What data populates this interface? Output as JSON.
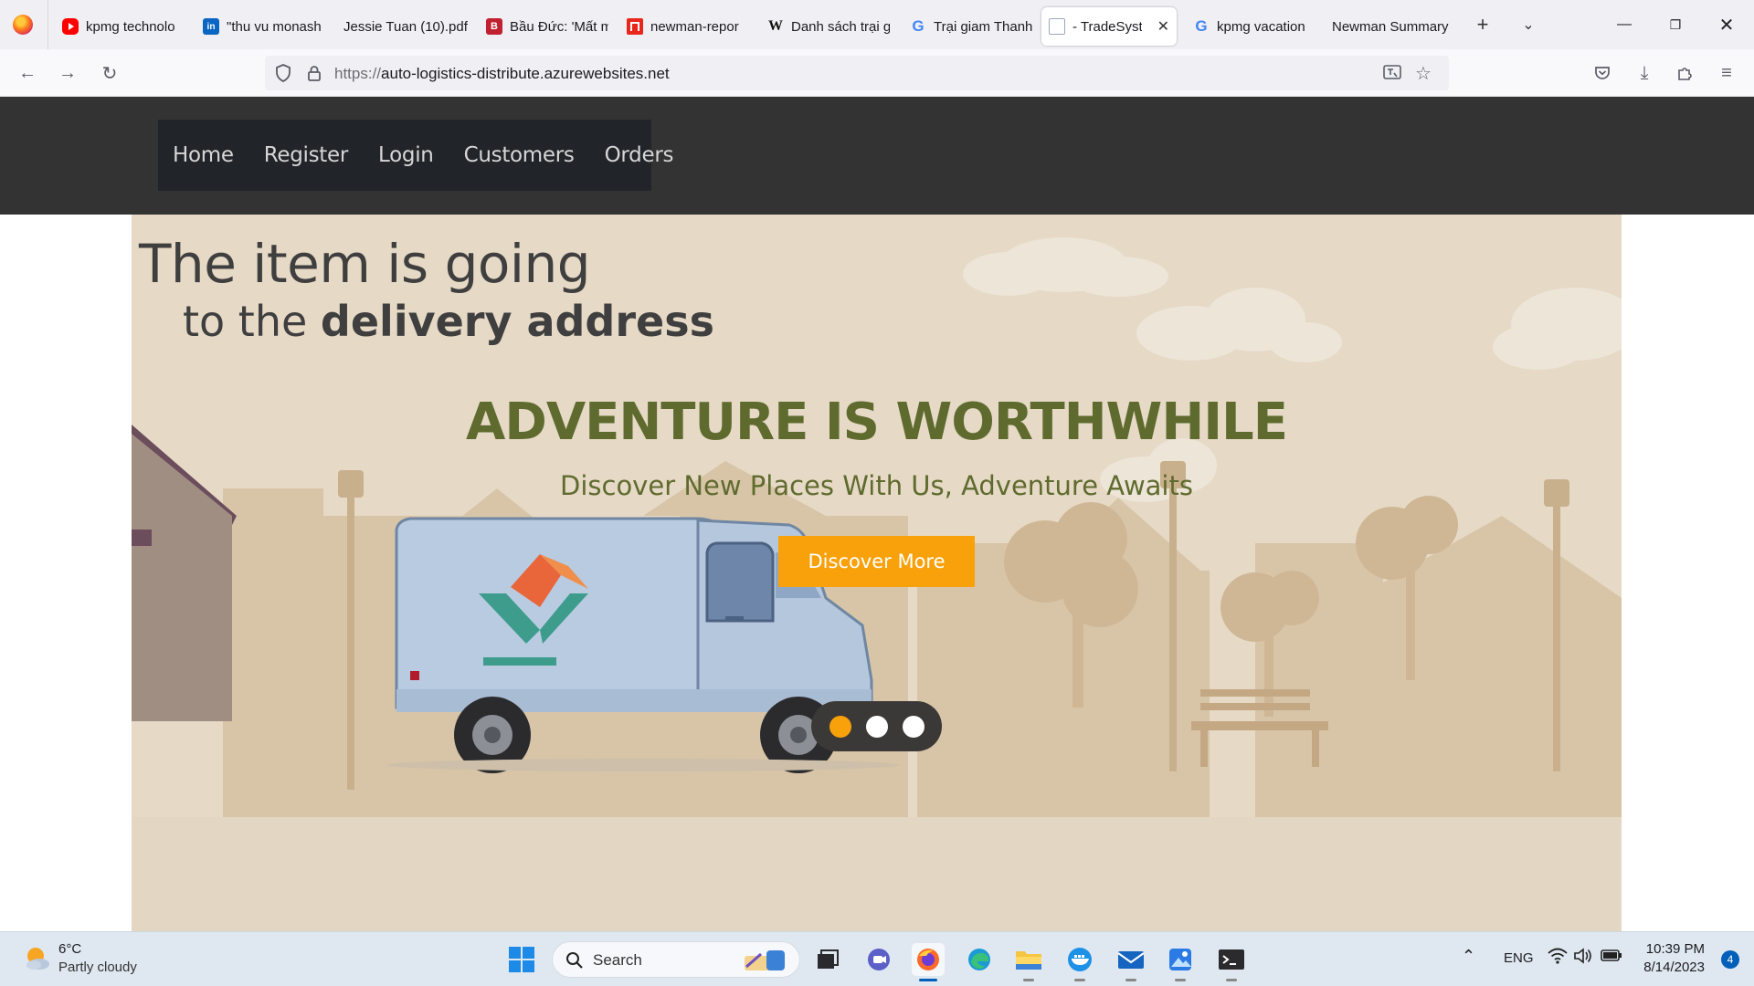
{
  "browser": {
    "tabs": [
      {
        "label": "kpmg technolo",
        "icon": "youtube-icon"
      },
      {
        "label": "\"thu vu monash",
        "icon": "linkedin-icon"
      },
      {
        "label": "Jessie Tuan (10).pdf",
        "icon": "pdf-icon"
      },
      {
        "label": "Bầu Đức: 'Mất m",
        "icon": "news-icon"
      },
      {
        "label": "newman-repor",
        "icon": "newman-icon"
      },
      {
        "label": "Danh sách trại g",
        "icon": "wikipedia-icon"
      },
      {
        "label": "Trại giam Thanh",
        "icon": "google-icon"
      },
      {
        "label": "- TradeSyste",
        "icon": "page-icon",
        "active": true
      },
      {
        "label": "kpmg vacation",
        "icon": "google-icon"
      },
      {
        "label": "Newman Summary",
        "icon": "none"
      }
    ],
    "url_protocol": "https://",
    "url_host": "auto-logistics-distribute.azurewebsites.net"
  },
  "site": {
    "nav": [
      "Home",
      "Register",
      "Login",
      "Customers",
      "Orders"
    ],
    "hero": {
      "animated_line1_part1": "The item",
      "animated_line1_part2": " is ",
      "animated_line1_part3": "going",
      "animated_line2_part1": "to the ",
      "animated_line2_part2": "delivery address",
      "title": "ADVENTURE IS WORTHWHILE",
      "subtitle": "Discover New Places With Us, Adventure Awaits",
      "button": "Discover More",
      "carousel_active_index": 0,
      "carousel_count": 3
    }
  },
  "taskbar": {
    "weather_temp": "6°C",
    "weather_desc": "Partly cloudy",
    "search_label": "Search",
    "language": "ENG",
    "time": "10:39 PM",
    "date": "8/14/2023",
    "notification_count": "4"
  },
  "colors": {
    "site_header": "#333333",
    "site_nav": "#212529",
    "hero_text": "#5f6b2e",
    "accent_orange": "#f8a10b"
  }
}
